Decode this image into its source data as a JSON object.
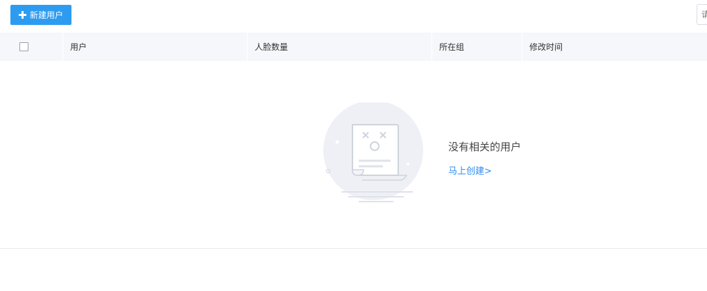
{
  "toolbar": {
    "new_user_label": "新建用户",
    "search_placeholder": "请"
  },
  "table": {
    "columns": [
      "用户",
      "人脸数量",
      "所在组",
      "修改时间"
    ]
  },
  "empty": {
    "message": "没有相关的用户",
    "create_link": "马上创建>"
  },
  "colors": {
    "primary": "#2d9cf0",
    "link": "#2d8cf0",
    "header_bg": "#f5f7fa",
    "illustration": "#eef0f6"
  },
  "icons": {
    "new_user_button": "plus-icon",
    "empty_state": "empty-document-icon"
  }
}
